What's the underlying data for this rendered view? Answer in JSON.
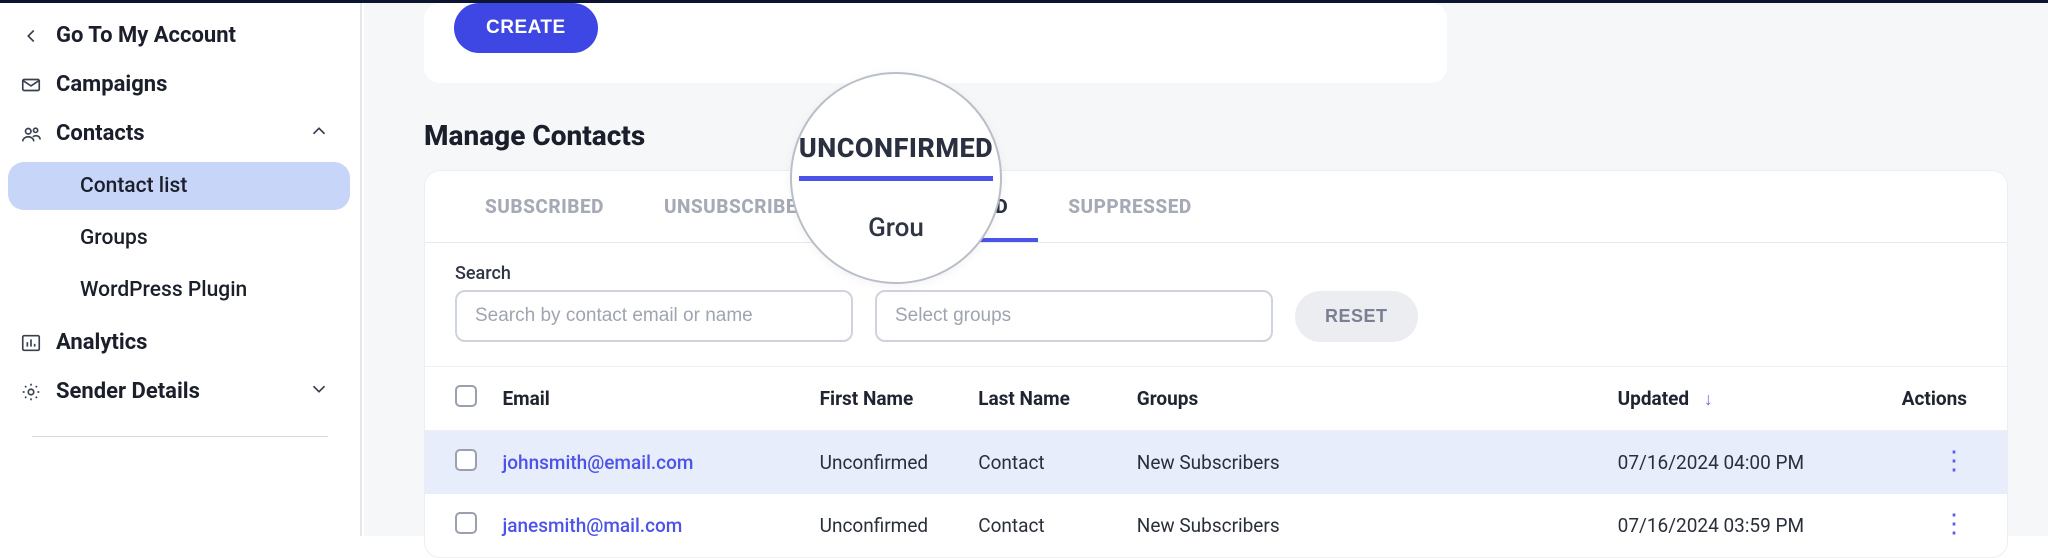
{
  "sidebar": {
    "back_label": "Go To My Account",
    "items": {
      "campaigns": "Campaigns",
      "contacts": "Contacts",
      "analytics": "Analytics",
      "sender_details": "Sender Details"
    },
    "subitems": {
      "contact_list": "Contact list",
      "groups": "Groups",
      "wp_plugin": "WordPress Plugin"
    }
  },
  "toolbar": {
    "create_label": "CREATE"
  },
  "page": {
    "title": "Manage Contacts"
  },
  "tabs": {
    "subscribed": "SUBSCRIBED",
    "unsubscribed": "UNSUBSCRIBED",
    "unconfirmed": "UNCONFIRMED",
    "suppressed": "SUPPRESSED"
  },
  "filters": {
    "search_label": "Search",
    "search_placeholder": "Search by contact email or name",
    "groups_label": "Grou",
    "groups_placeholder": "Select groups",
    "reset_label": "RESET"
  },
  "table": {
    "headers": {
      "email": "Email",
      "first_name": "First Name",
      "last_name": "Last Name",
      "groups": "Groups",
      "updated": "Updated",
      "actions": "Actions"
    },
    "rows": [
      {
        "email": "johnsmith@email.com",
        "first_name": "Unconfirmed",
        "last_name": "Contact",
        "groups": "New Subscribers",
        "updated": "07/16/2024 04:00 PM"
      },
      {
        "email": "janesmith@mail.com",
        "first_name": "Unconfirmed",
        "last_name": "Contact",
        "groups": "New Subscribers",
        "updated": "07/16/2024 03:59 PM"
      }
    ]
  },
  "magnifier": {
    "tab": "UNCONFIRMED",
    "below": "Grou"
  }
}
